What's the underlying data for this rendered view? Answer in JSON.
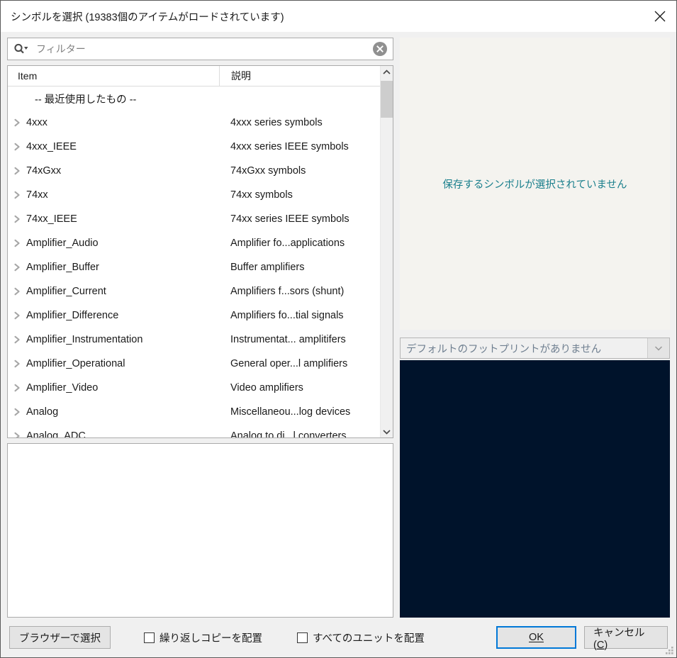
{
  "window": {
    "title": "シンボルを選択 (19383個のアイテムがロードされています)",
    "close_icon": "close-icon"
  },
  "filter": {
    "placeholder": "フィルター",
    "value": "",
    "search_icon": "search-dropdown-icon",
    "clear_icon": "clear-circle-icon"
  },
  "tree": {
    "columns": [
      "Item",
      "説明"
    ],
    "rows": [
      {
        "name": "-- 最近使用したもの --",
        "desc": "",
        "expandable": false,
        "section": true
      },
      {
        "name": "4xxx",
        "desc": "4xxx series symbols",
        "expandable": true,
        "section": false
      },
      {
        "name": "4xxx_IEEE",
        "desc": "4xxx series IEEE symbols",
        "expandable": true,
        "section": false
      },
      {
        "name": "74xGxx",
        "desc": "74xGxx symbols",
        "expandable": true,
        "section": false
      },
      {
        "name": "74xx",
        "desc": "74xx symbols",
        "expandable": true,
        "section": false
      },
      {
        "name": "74xx_IEEE",
        "desc": "74xx series IEEE symbols",
        "expandable": true,
        "section": false
      },
      {
        "name": "Amplifier_Audio",
        "desc": "Amplifier fo...applications",
        "expandable": true,
        "section": false
      },
      {
        "name": "Amplifier_Buffer",
        "desc": "Buffer amplifiers",
        "expandable": true,
        "section": false
      },
      {
        "name": "Amplifier_Current",
        "desc": "Amplifiers f...sors (shunt)",
        "expandable": true,
        "section": false
      },
      {
        "name": "Amplifier_Difference",
        "desc": "Amplifiers fo...tial signals",
        "expandable": true,
        "section": false
      },
      {
        "name": "Amplifier_Instrumentation",
        "desc": "Instrumentat... amplitifers",
        "expandable": true,
        "section": false
      },
      {
        "name": "Amplifier_Operational",
        "desc": "General oper...l amplifiers",
        "expandable": true,
        "section": false
      },
      {
        "name": "Amplifier_Video",
        "desc": "Video amplifiers",
        "expandable": true,
        "section": false
      },
      {
        "name": "Analog",
        "desc": "Miscellaneou...log devices",
        "expandable": true,
        "section": false
      },
      {
        "name": "Analog_ADC",
        "desc": "Analog to di...l converters",
        "expandable": true,
        "section": false
      }
    ]
  },
  "preview": {
    "no_symbol_message": "保存するシンボルが選択されていません",
    "message_color": "#1a7f8c",
    "canvas_color": "#00132b",
    "panel_color": "#f4f3ef"
  },
  "footprint": {
    "selected": "デフォルトのフットプリントがありません",
    "arrow_icon": "chevron-down-icon"
  },
  "bottom": {
    "browse_label": "ブラウザーで選択",
    "repeat_label": "繰り返しコピーを配置",
    "repeat_checked": false,
    "all_units_label": "すべてのユニットを配置",
    "all_units_checked": false,
    "ok_label": "OK",
    "ok_accel": "O",
    "cancel_label": "キャンセル (C)",
    "focus_color": "#0078d7"
  }
}
